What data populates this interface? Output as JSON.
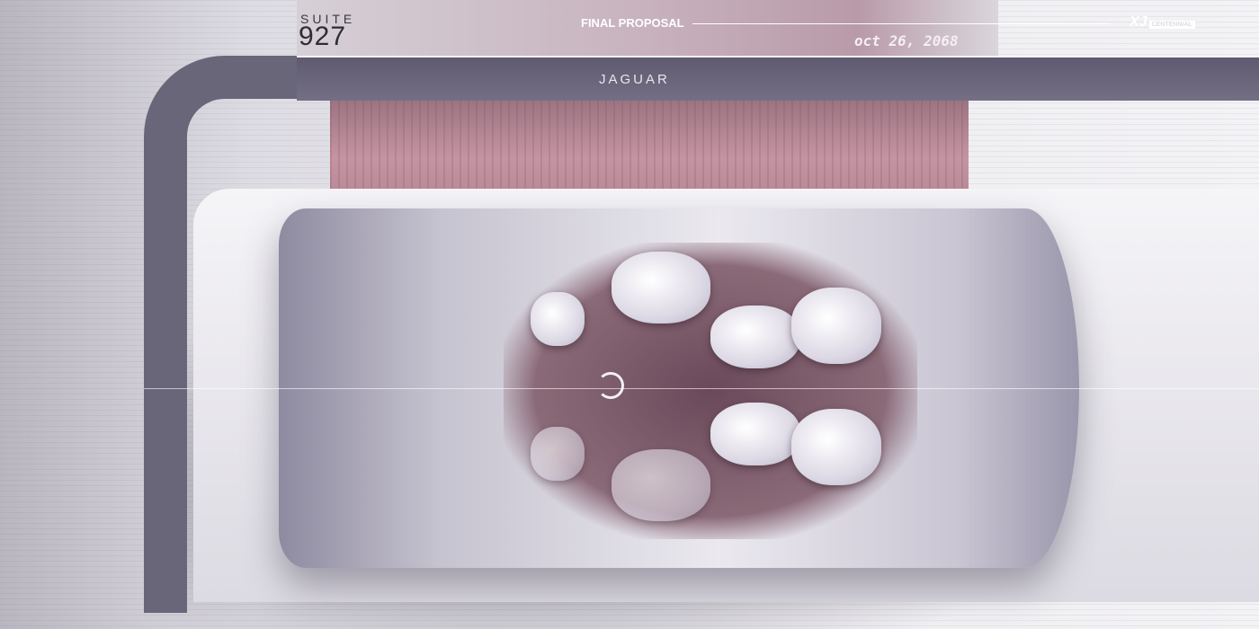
{
  "header": {
    "suite_label": "SUITE",
    "suite_number": "927",
    "title": "FINAL PROPOSAL",
    "date": "oct 26, 2068"
  },
  "logo": {
    "mark": "XJ",
    "subtitle": "CENTENNIAL"
  },
  "beam": {
    "brand": "JAGUAR"
  }
}
